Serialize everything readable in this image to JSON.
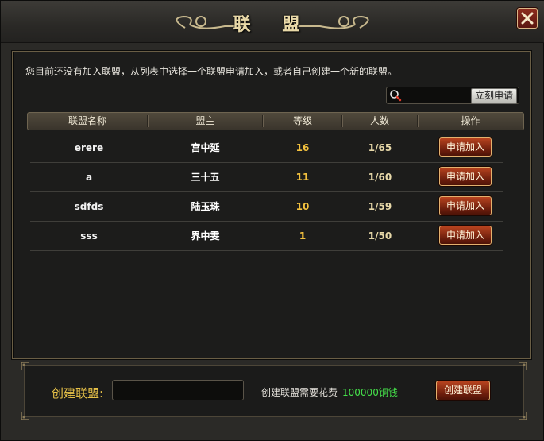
{
  "window": {
    "title": "联 盟",
    "close_icon": "close-icon"
  },
  "intro_text": "您目前还没有加入联盟，从列表中选择一个联盟申请加入，或者自己创建一个新的联盟。",
  "search": {
    "icon": "search-icon",
    "value": "",
    "button_label": "立刻申请"
  },
  "table": {
    "headers": [
      "联盟名称",
      "盟主",
      "等级",
      "人数",
      "操作"
    ],
    "rows": [
      {
        "name": "erere",
        "leader": "宫中延",
        "level": "16",
        "members": "1/65",
        "action": "申请加入"
      },
      {
        "name": "a",
        "leader": "三十五",
        "level": "11",
        "members": "1/60",
        "action": "申请加入"
      },
      {
        "name": "sdfds",
        "leader": "陆玉珠",
        "level": "10",
        "members": "1/59",
        "action": "申请加入"
      },
      {
        "name": "sss",
        "leader": "界中雯",
        "level": "1",
        "members": "1/50",
        "action": "申请加入"
      }
    ]
  },
  "create": {
    "label": "创建联盟:",
    "input_value": "",
    "cost_text": "创建联盟需要花费",
    "cost_amount": "100000铜钱",
    "button_label": "创建联盟"
  },
  "colors": {
    "level": "#f3c13e",
    "cost_amount": "#45e04a",
    "create_label": "#e8c248",
    "title": "#e9d9a8"
  }
}
